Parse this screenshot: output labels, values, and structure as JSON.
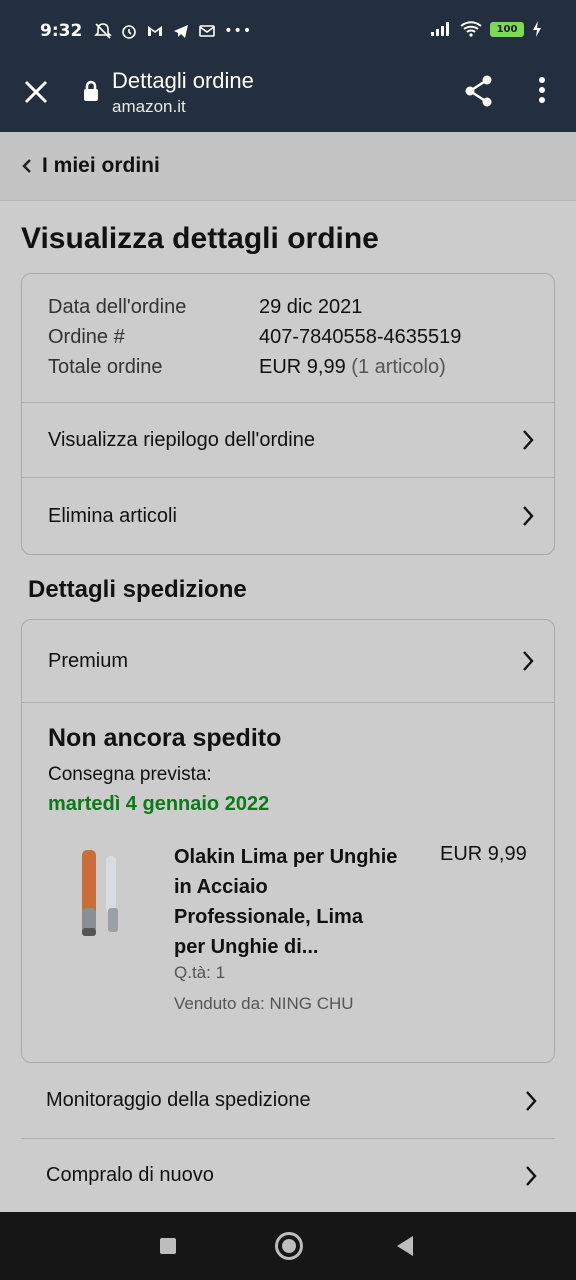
{
  "status_bar": {
    "time": "9:32",
    "battery": "100",
    "more_indicator": "•••"
  },
  "app_bar": {
    "title": "Dettagli ordine",
    "url": "amazon.it"
  },
  "breadcrumb": {
    "label": "I miei ordini"
  },
  "page_title": "Visualizza dettagli ordine",
  "order_info": {
    "date_label": "Data dell'ordine",
    "date_value": "29 dic 2021",
    "number_label": "Ordine #",
    "number_value": "407-7840558-4635519",
    "total_label": "Totale ordine",
    "total_value": "EUR 9,99",
    "total_items": "(1 articolo)"
  },
  "order_actions": [
    {
      "label": "Visualizza riepilogo dell'ordine"
    },
    {
      "label": "Elimina articoli"
    }
  ],
  "shipping": {
    "section_title": "Dettagli spedizione",
    "speed": "Premium",
    "status": "Non ancora spedito",
    "eta_label": "Consegna prevista:",
    "eta_date": "martedì 4 gennaio 2022",
    "eta_color": "#0d7a1a"
  },
  "product": {
    "title": "Olakin Lima per Unghie in Acciaio Professionale, Lima per Unghie di...",
    "price": "EUR 9,99",
    "qty": "Q.tà: 1",
    "seller": "Venduto da: NING CHU"
  },
  "bottom_actions": [
    {
      "label": "Monitoraggio della spedizione"
    },
    {
      "label": "Compralo di nuovo"
    }
  ],
  "colors": {
    "header_bg": "#232f3e",
    "page_bg": "#cccccc"
  }
}
